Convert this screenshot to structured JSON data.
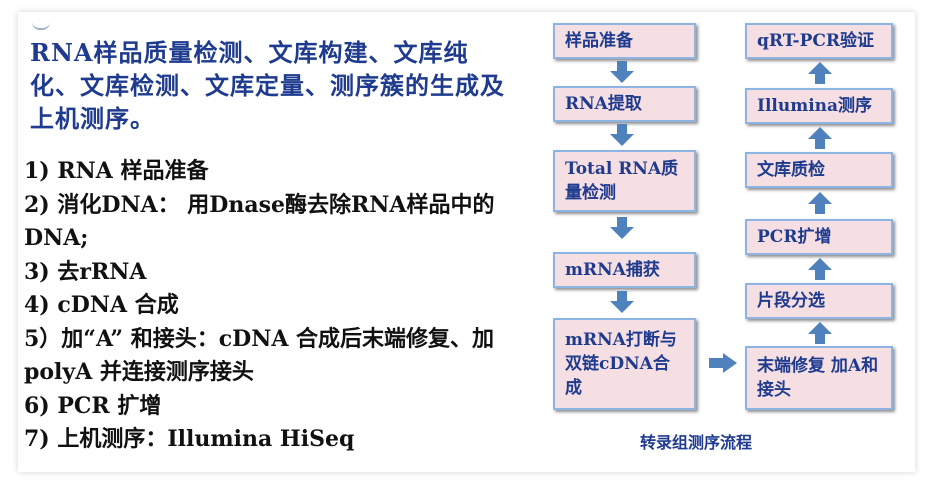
{
  "title": "RNA样品质量检测、文库构建、文库纯化、文库检测、文库定量、测序簇的生成及上机测序。",
  "steps": [
    "1) RNA 样品准备",
    "2) 消化DNA： 用Dnase酶去除RNA样品中的DNA;",
    "3) 去rRNA",
    "4) cDNA 合成",
    "5）加“A” 和接头：cDNA 合成后末端修复、加polyA 并连接测序接头",
    "6) PCR 扩增",
    "7) 上机测序：Illumina HiSeq"
  ],
  "flow_left": [
    "样品准备",
    "RNA提取",
    "Total RNA质量检测",
    "mRNA捕获",
    "mRNA打断与双链cDNA合成"
  ],
  "flow_right": [
    "末端修复 加A和接头",
    "片段分选",
    "PCR扩增",
    "文库质检",
    "Illumina测序",
    "qRT-PCR验证"
  ],
  "caption": "转录组测序流程",
  "colors": {
    "box_fill": "#f5dfe2",
    "box_border": "#8eb4e3",
    "arrow": "#4f81bd",
    "text": "#1f3b8f"
  }
}
